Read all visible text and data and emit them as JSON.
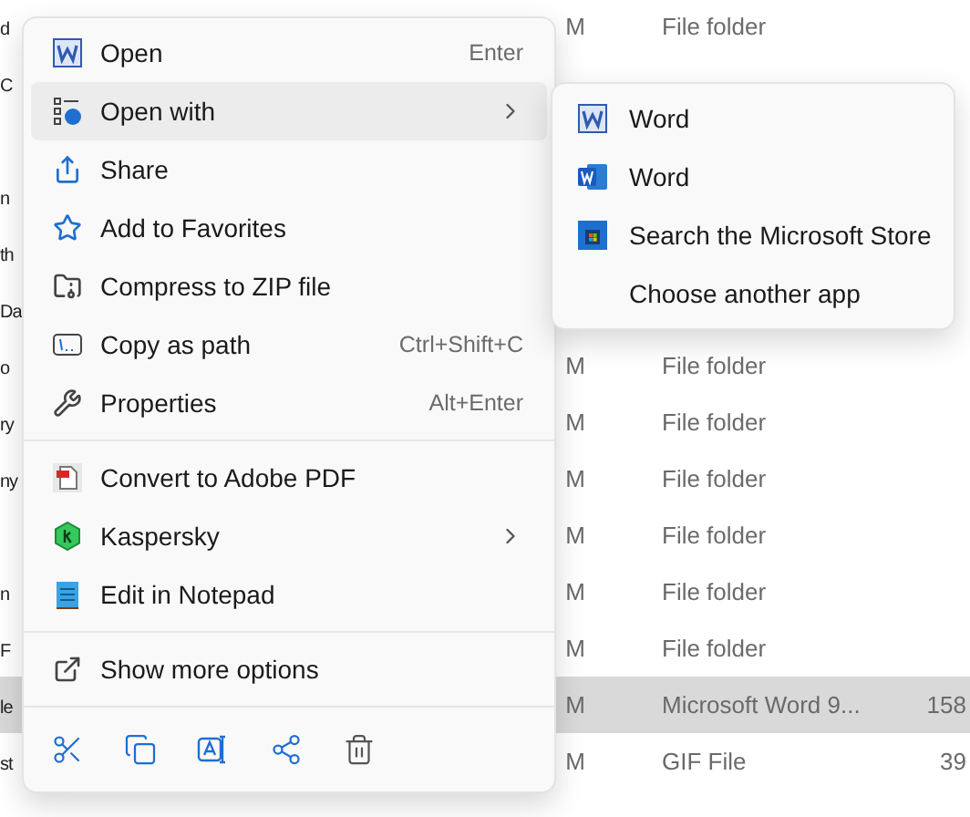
{
  "file_list": {
    "rows": [
      {
        "name": "d",
        "date": "M",
        "type": "File folder",
        "selected": false
      },
      {
        "name": "C",
        "selected": false
      },
      {
        "selected": false
      },
      {
        "name": "n",
        "selected": false
      },
      {
        "name": "th",
        "selected": false
      },
      {
        "name": "Da",
        "selected": false
      },
      {
        "name": "o",
        "date": "M",
        "type": "File folder",
        "selected": false
      },
      {
        "name": "ry",
        "date": "M",
        "type": "File folder",
        "selected": false
      },
      {
        "name": "ny",
        "date": "M",
        "type": "File folder",
        "selected": false
      },
      {
        "date": "M",
        "type": "File folder",
        "selected": false
      },
      {
        "name": "n",
        "date": "M",
        "type": "File folder",
        "selected": false
      },
      {
        "name": "F",
        "date": "M",
        "type": "File folder",
        "selected": false
      },
      {
        "name": "le",
        "date": "M",
        "type": "Microsoft Word 9...",
        "size": "158",
        "selected": true
      },
      {
        "name": "st",
        "date": "M",
        "type": "GIF File",
        "size": "39",
        "selected": false
      }
    ]
  },
  "context_menu": {
    "sections": [
      [
        {
          "label": "Open",
          "shortcut": "Enter",
          "highlighted": false
        },
        {
          "label": "Open with",
          "has_submenu": true,
          "highlighted": true
        },
        {
          "label": "Share",
          "highlighted": false
        },
        {
          "label": "Add to Favorites",
          "highlighted": false
        },
        {
          "label": "Compress to ZIP file",
          "highlighted": false
        },
        {
          "label": "Copy as path",
          "shortcut": "Ctrl+Shift+C",
          "highlighted": false
        },
        {
          "label": "Properties",
          "shortcut": "Alt+Enter",
          "highlighted": false
        }
      ],
      [
        {
          "label": "Convert to Adobe PDF",
          "highlighted": false
        },
        {
          "label": "Kaspersky",
          "has_submenu": true,
          "highlighted": false
        },
        {
          "label": "Edit in Notepad",
          "highlighted": false
        }
      ],
      [
        {
          "label": "Show more options",
          "highlighted": false
        }
      ]
    ]
  },
  "open_with_submenu": {
    "items": [
      {
        "label": "Word"
      },
      {
        "label": "Word"
      },
      {
        "label": "Search the Microsoft Store"
      },
      {
        "label": "Choose another app"
      }
    ]
  }
}
